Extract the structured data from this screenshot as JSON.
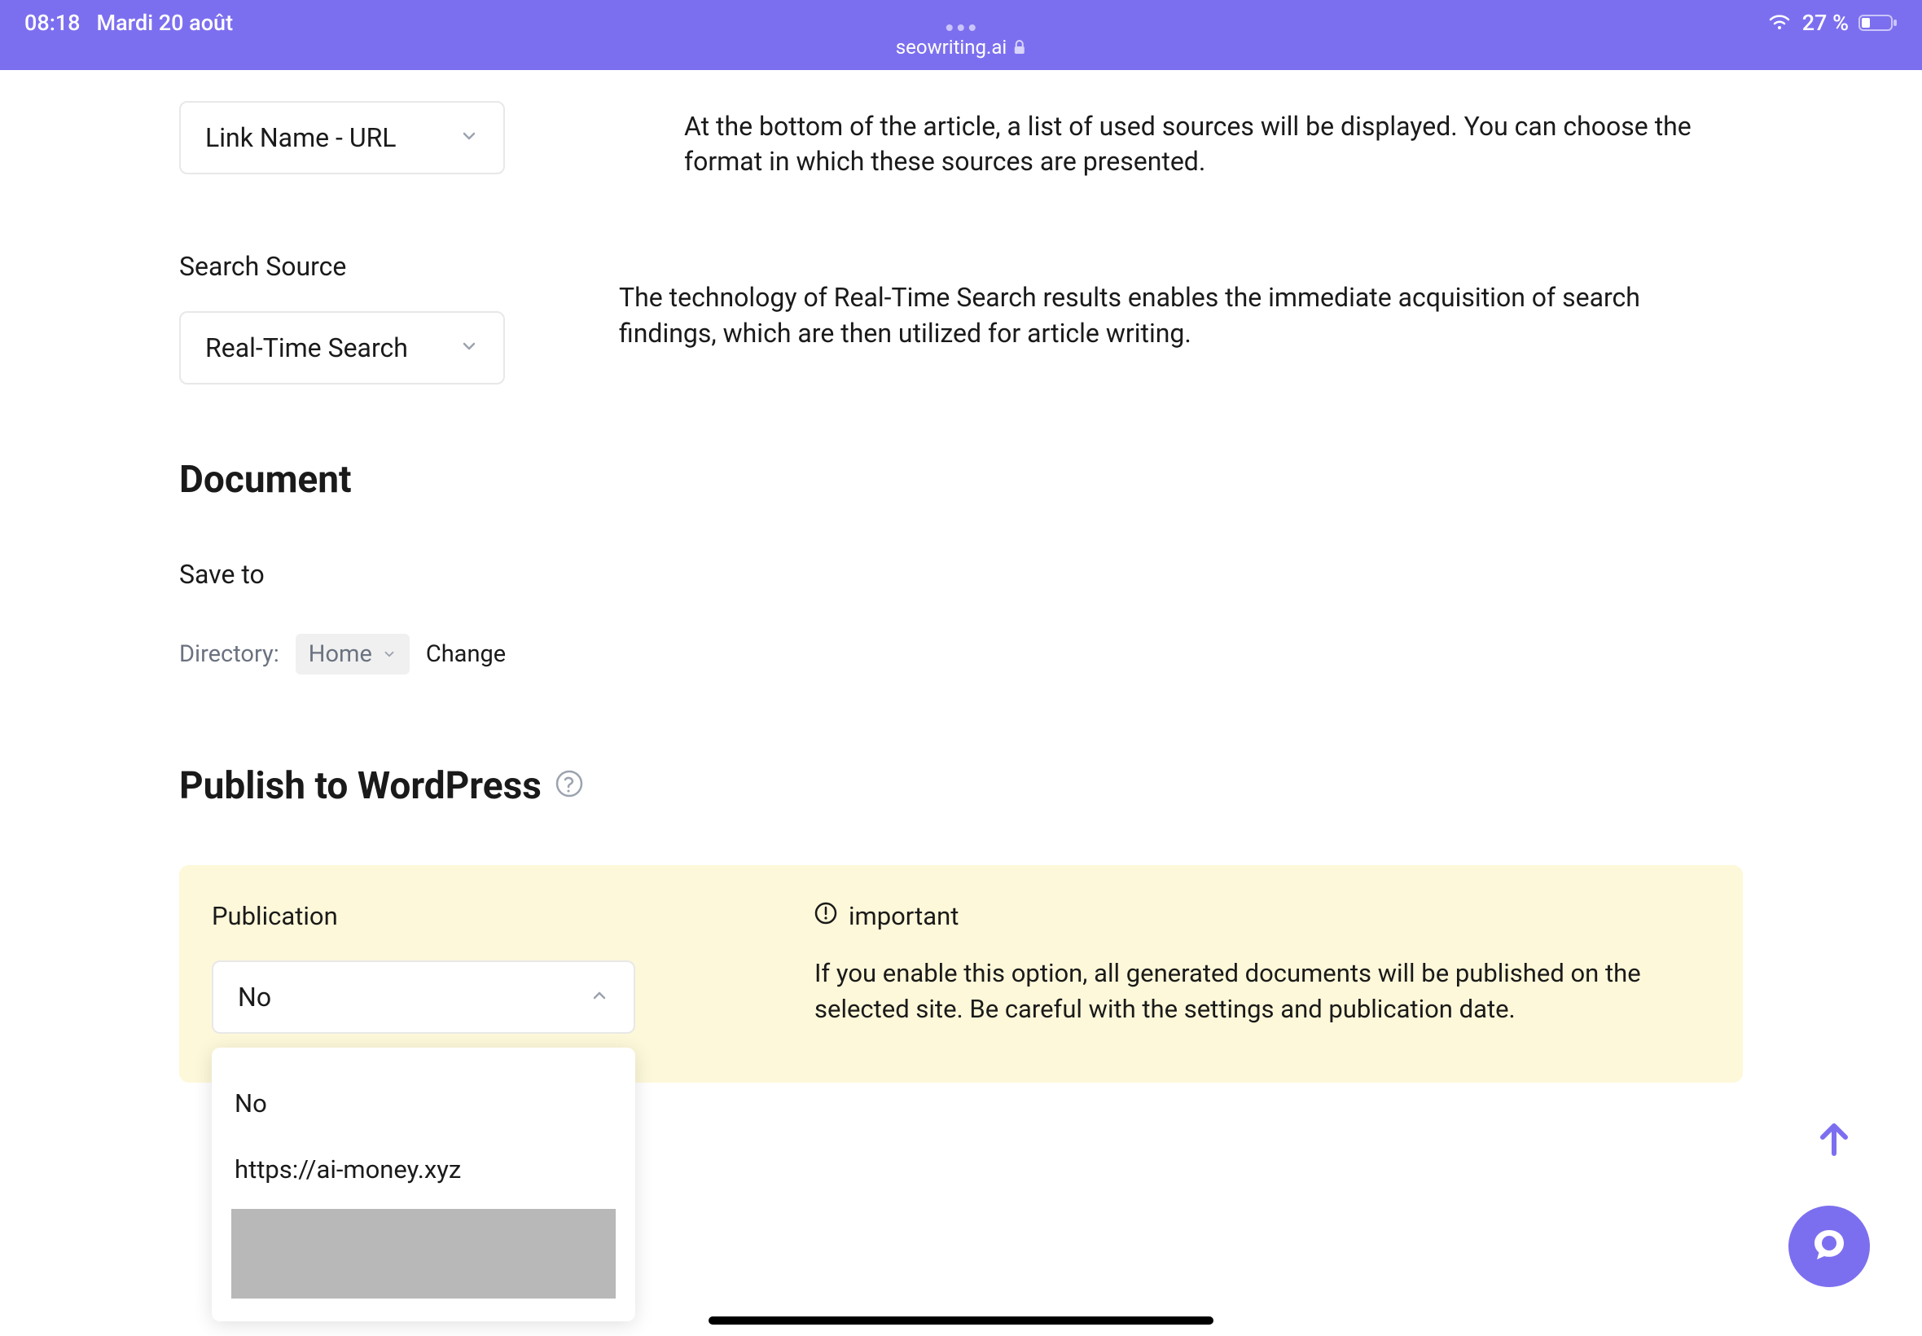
{
  "statusBar": {
    "time": "08:18",
    "date": "Mardi 20 août",
    "url": "seowriting.ai",
    "battery": "27 %"
  },
  "linkName": {
    "selectValue": "Link Name - URL",
    "description": "At the bottom of the article, a list of used sources will be displayed. You can choose the format in which these sources are presented."
  },
  "searchSource": {
    "label": "Search Source",
    "selectValue": "Real-Time Search",
    "description": "The technology of Real-Time Search results enables the immediate acquisition of search findings, which are then utilized for article writing."
  },
  "document": {
    "heading": "Document",
    "saveToLabel": "Save to",
    "directoryLabel": "Directory:",
    "directoryValue": "Home",
    "changeLabel": "Change"
  },
  "wordpress": {
    "heading": "Publish to WordPress",
    "publicationLabel": "Publication",
    "publicationValue": "No",
    "importantLabel": "important",
    "importantText": "If you enable this option, all generated documents will be published on the selected site. Be careful with the settings and publication date.",
    "dropdownOptions": {
      "option1": "No",
      "option2": "https://ai-money.xyz"
    }
  }
}
